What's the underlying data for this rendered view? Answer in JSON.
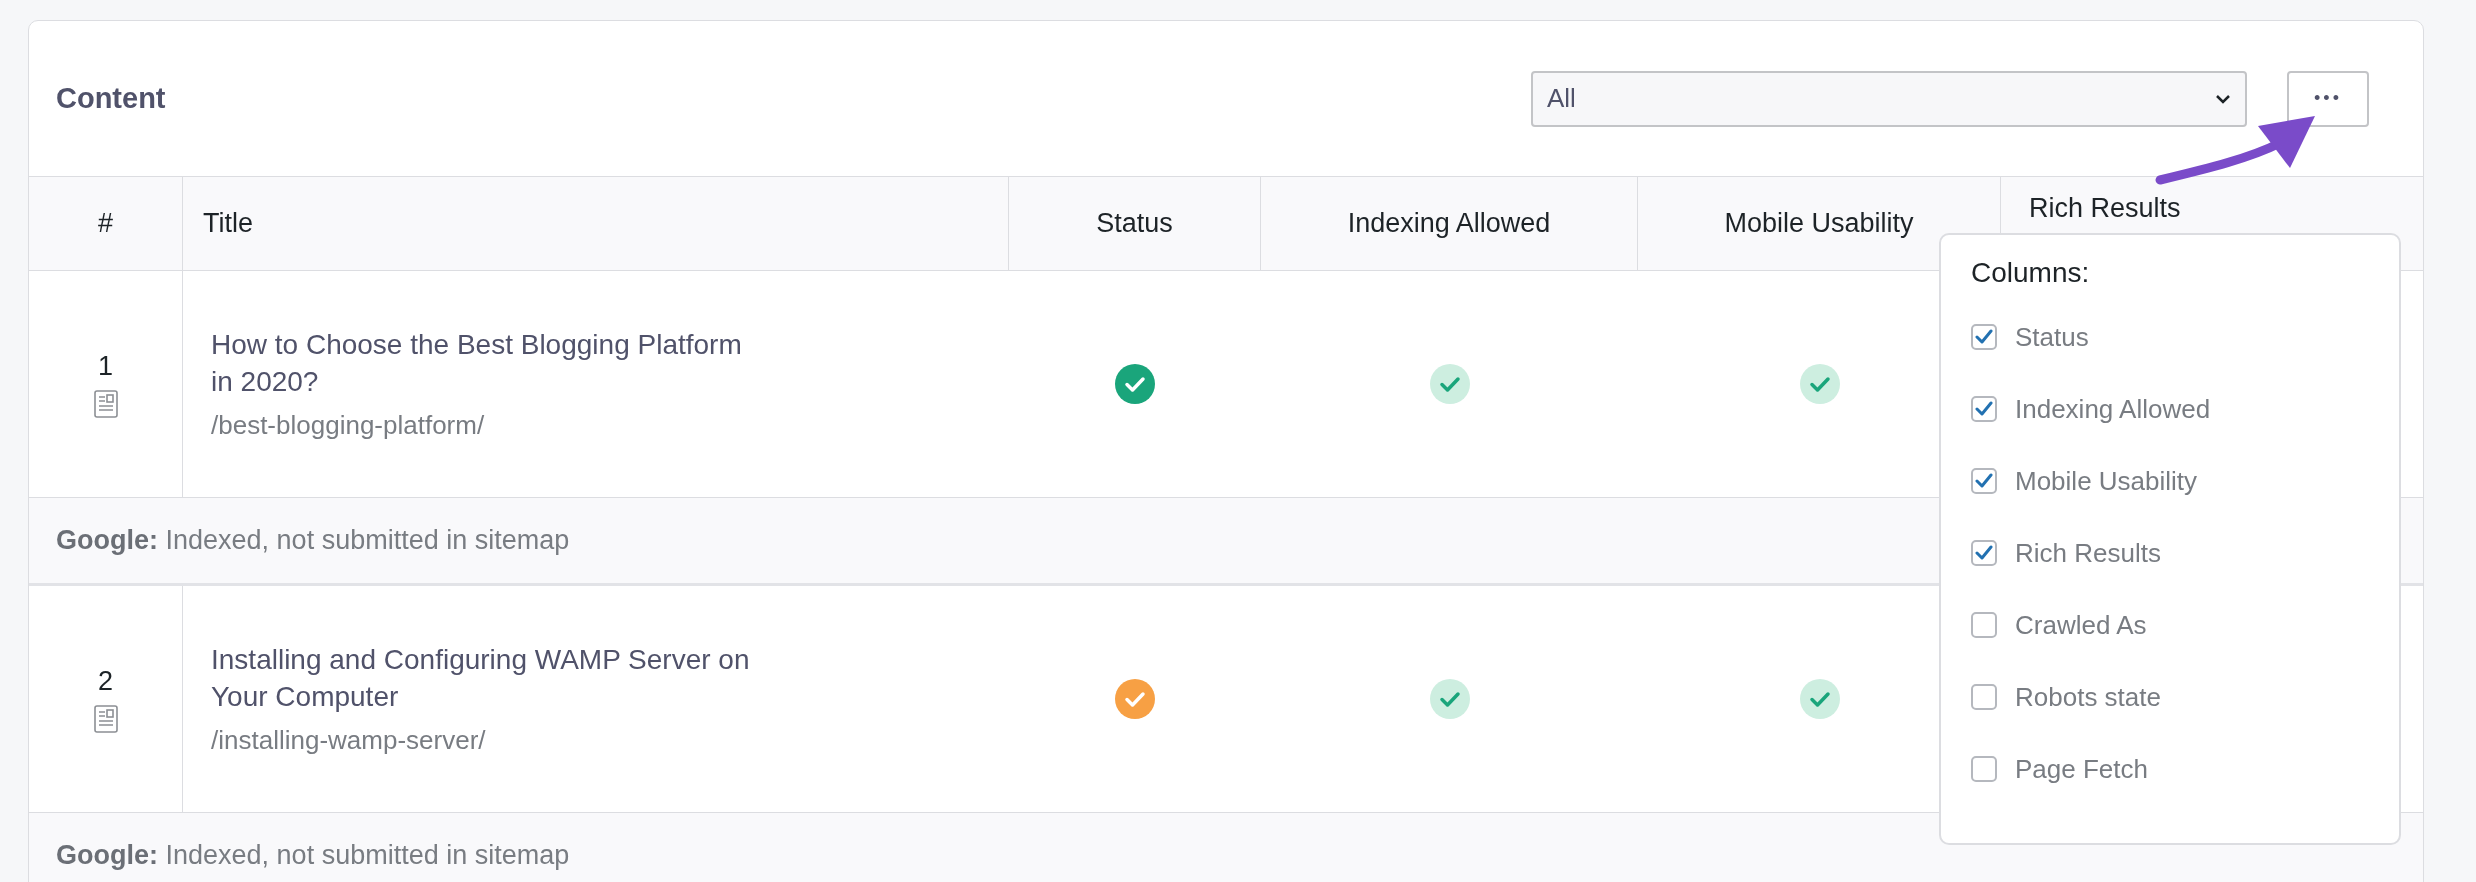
{
  "panel": {
    "title": "Content"
  },
  "filter": {
    "value": "All"
  },
  "more_button": {
    "label": "•••"
  },
  "table": {
    "columns": [
      "#",
      "Title",
      "Status",
      "Indexing Allowed",
      "Mobile Usability",
      "Rich Results"
    ],
    "rows": [
      {
        "number": "1",
        "title": "How to Choose the Best Blogging Platform in 2020?",
        "url": "/best-blogging-platform/",
        "status": {
          "kind": "pass"
        },
        "indexing": {
          "kind": "soft"
        },
        "mobile": {
          "kind": "soft"
        },
        "note_label": "Google:",
        "note": "Indexed, not submitted in sitemap"
      },
      {
        "number": "2",
        "title": "Installing and Configuring WAMP Server on Your Computer",
        "url": "/installing-wamp-server/",
        "status": {
          "kind": "warning"
        },
        "indexing": {
          "kind": "soft"
        },
        "mobile": {
          "kind": "soft"
        },
        "note_label": "Google:",
        "note": "Indexed, not submitted in sitemap"
      }
    ]
  },
  "columns_menu": {
    "title": "Columns:",
    "items": [
      {
        "label": "Status",
        "checked": true
      },
      {
        "label": "Indexing Allowed",
        "checked": true
      },
      {
        "label": "Mobile Usability",
        "checked": true
      },
      {
        "label": "Rich Results",
        "checked": true
      },
      {
        "label": "Crawled As",
        "checked": false
      },
      {
        "label": "Robots state",
        "checked": false
      },
      {
        "label": "Page Fetch",
        "checked": false
      }
    ]
  }
}
